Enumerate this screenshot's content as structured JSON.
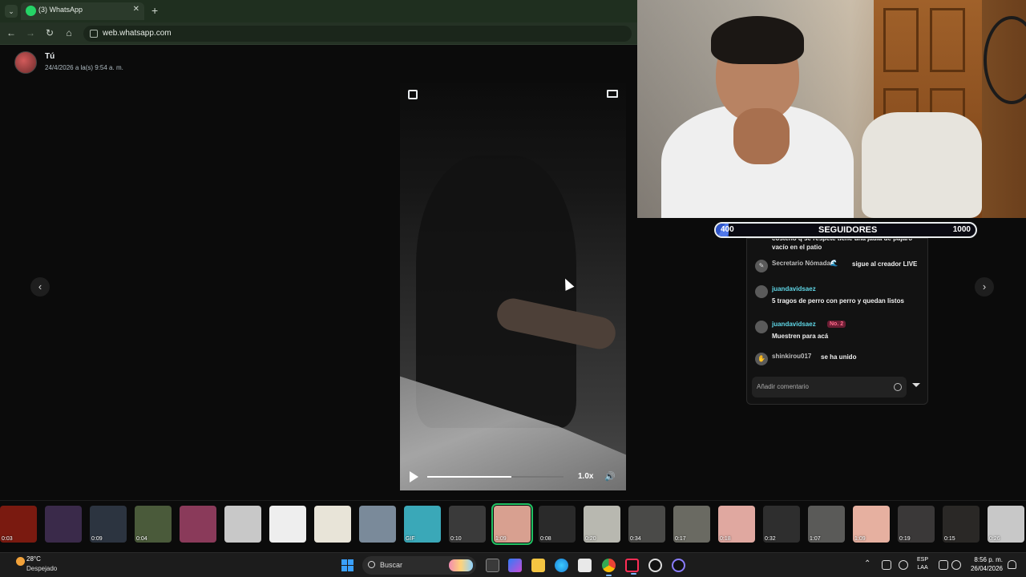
{
  "browser": {
    "tab_title": "(3) WhatsApp",
    "tab_close": "✕",
    "new_tab": "+",
    "menu_glyph": "⌄",
    "url": "web.whatsapp.com",
    "nav": {
      "back": "←",
      "forward": "→",
      "reload": "↻",
      "home": "⌂"
    }
  },
  "viewer": {
    "sender_name": "Tú",
    "sender_time": "24/4/2026 a la(s) 9:54 a. m.",
    "prev_arrow": "‹",
    "next_arrow": "›",
    "video": {
      "speed": "1.0x",
      "volume_glyph": "🔊",
      "progress": 0.62
    }
  },
  "stream_overlay": {
    "goal": {
      "start": "400",
      "label": "SEGUIDORES",
      "end": "1000",
      "progress": 0.05
    },
    "chat": {
      "cut_text": "costeño q se respete tiene una jaula de pájaro vacío en el patio",
      "messages": [
        {
          "user": "Secretario Nómada🌊",
          "text": "sigue al creador LIVE",
          "user_color": "#bdbdbd"
        },
        {
          "user": "juandavidsaez",
          "text": "5 tragos de perro con perro y quedan listos",
          "user_color": "#5fd6e6"
        },
        {
          "user": "juandavidsaez",
          "badge": "No. 2",
          "text": "Muestren para acá",
          "user_color": "#5fd6e6"
        },
        {
          "user": "shinkirou017",
          "text": "se ha unido",
          "user_color": "#bdbdbd"
        }
      ],
      "input_placeholder": "Añadir comentario"
    }
  },
  "thumbnails": [
    {
      "duration": "0:03",
      "color": "#7a1a10"
    },
    {
      "duration": "",
      "color": "#3a2a4a"
    },
    {
      "duration": "0:09",
      "color": "#2c3440"
    },
    {
      "duration": "0:04",
      "color": "#4a5a3a"
    },
    {
      "duration": "",
      "color": "#8a3a5a"
    },
    {
      "duration": "",
      "color": "#c8c8c8"
    },
    {
      "duration": "",
      "color": "#eeeeee"
    },
    {
      "duration": "",
      "color": "#e8e4d8"
    },
    {
      "duration": "",
      "color": "#7a8a9a"
    },
    {
      "duration": "GIF",
      "color": "#3aa8b8"
    },
    {
      "duration": "0:10",
      "color": "#3a3a3a"
    },
    {
      "duration": "1:09",
      "color": "#d8a090",
      "selected": true
    },
    {
      "duration": "0:08",
      "color": "#2a2a2a"
    },
    {
      "duration": "0:20",
      "color": "#b8b8b0"
    },
    {
      "duration": "0:34",
      "color": "#4a4a48"
    },
    {
      "duration": "0:17",
      "color": "#6a6a62"
    },
    {
      "duration": "0:18",
      "color": "#e0a8a0"
    },
    {
      "duration": "0:32",
      "color": "#2e2e2e"
    },
    {
      "duration": "1:07",
      "color": "#5a5a58"
    },
    {
      "duration": "1:09",
      "color": "#e6b0a0"
    },
    {
      "duration": "0:19",
      "color": "#3a3838"
    },
    {
      "duration": "0:15",
      "color": "#2a2826"
    },
    {
      "duration": "0:26",
      "color": "#c8c8c8"
    }
  ],
  "taskbar": {
    "weather_temp": "28°C",
    "weather_desc": "Despejado",
    "search_label": "Buscar",
    "language": "ESP",
    "language_sub": "LAA",
    "time": "8:56 p. m.",
    "date": "26/04/2026",
    "caret": "⌃"
  }
}
